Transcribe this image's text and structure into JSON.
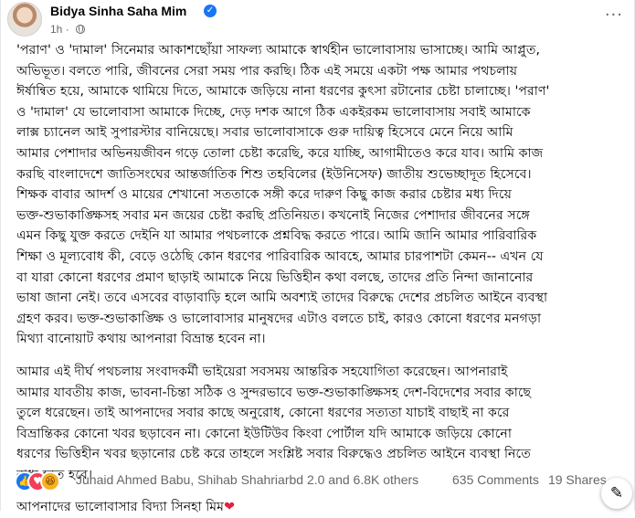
{
  "post": {
    "author": "Bidya Sinha Saha Mim",
    "time": "1h",
    "meta_separator": "·",
    "more_label": "···",
    "verified_mark": "✓",
    "paragraphs": [
      [
        "'পরাণ' ও 'দামাল' সিনেমার আকাশছোঁয়া সাফল্য আমাকে স্বার্থহীন ভালোবাসায় ভাসাচ্ছে। আমি আপ্লুত,",
        "অভিভূত। বলতে পারি, জীবনের সেরা সময় পার করছি। ঠিক এই সময়ে একটা পক্ষ আমার পথচলায়",
        "ঈর্ষান্বিত হয়ে, আমাকে থামিয়ে দিতে, আমাকে জড়িয়ে নানা ধরণের কুৎসা রটানোর চেষ্টা চালাচ্ছে। 'পরাণ'",
        "ও 'দামাল' যে ভালোবাসা আমাকে দিচ্ছে, দেড় দশক আগে ঠিক একইরকম ভালোবাসায় সবাই আমাকে",
        "লাক্স চ্যানেল আই সুপারস্টার বানিয়েছে। সবার ভালোবাসাকে গুরু দায়িত্ব হিসেবে মেনে নিয়ে আমি",
        "আমার পেশাদার অভিনয়জীবন গড়ে তোলা চেষ্টা করেছি, করে যাচ্ছি, আগামীতেও করে যাব। আমি কাজ",
        "করছি বাংলাদেশে জাতিসংঘের আন্তর্জাতিক শিশু তহবিলের (ইউনিসেফ) জাতীয় শুভেচ্ছাদূত হিসেবে।",
        "শিক্ষক বাবার আদর্শ ও মায়ের শেখানো সততাকে সঙ্গী করে দারুণ কিছু কাজ করার চেষ্টার মধ্য দিয়ে",
        "ভক্ত-শুভাকাঙ্ক্ষিসহ সবার মন জয়ের চেষ্টা করছি প্রতিনিয়ত। কখনোই নিজের পেশাদার জীবনের সঙ্গে",
        "এমন কিছু যুক্ত করতে দেইনি যা আমার পথচলাকে প্রশ্নবিদ্ধ করতে পারে। আমি জানি আমার পারিবারিক",
        "শিক্ষা ও মূল্যবোধ কী, বেড়ে ওঠেছি কোন ধরণের পারিবারিক আবহে, আমার চারপাশটা কেমন-- এখন যে",
        "বা যারা কোনো ধরণের প্রমাণ ছাড়াই আমাকে নিয়ে ভিত্তিহীন কথা বলছে, তাদের প্রতি নিন্দা জানানোর",
        "ভাষা জানা নেই। তবে এসবের বাড়াবাড়ি হলে আমি অবশ্যই তাদের বিরুদ্ধে দেশের প্রচলিত আইনে ব্যবস্থা",
        "গ্রহণ করব। ভক্ত-শুভাকাঙ্ক্ষি ও ভালোবাসার মানুষদের এটাও বলতে চাই, কারও কোনো ধরণের মনগড়া",
        "মিথ্যা বানোয়াট কথায় আপনারা বিভ্রান্ত হবেন না।"
      ],
      [
        "আমার এই দীর্ঘ পথচলায় সংবাদকর্মী ভাইয়েরা সবসময় আন্তরিক সহযোগিতা করেছেন। আপনারাই",
        "আমার যাবতীয় কাজ, ভাবনা-চিন্তা সঠিক ও সুন্দরভাবে ভক্ত-শুভাকাঙ্ক্ষিসহ দেশ-বিদেশের সবার কাছে",
        "তুলে ধরেছেন। তাই আপনাদের সবার কাছে অনুরোধ, কোনো ধরণের সত্যতা যাচাই বাছাই না করে",
        "বিভ্রান্তিকর কোনো খবর ছড়াবেন না। কোনো ইউটিউব কিংবা পোর্টাল যদি আমাকে জড়িয়ে কোনো",
        "ধরণের ভিত্তিহীন খবর ছড়ানোর চেষ্ট করে তাহলে সংশ্লিষ্ট সবার বিরুদ্ধেও প্রচলিত আইনে ব্যবস্থা নিতে",
        "বাধ্য হতে হবে।"
      ]
    ],
    "signature": "আপনাদের ভালোবাসার বিদ্যা সিনহা মিম",
    "signature_heart": "❤"
  },
  "footer": {
    "reaction_icons": [
      "like-icon",
      "love-icon",
      "haha-icon"
    ],
    "reaction_glyphs": {
      "like": "👍",
      "love": "♥",
      "haha": "😆"
    },
    "reactions_text": "Junaid Ahmed Babu, Shihab Shahriarbd 2.0 and 6.8K others",
    "comments": "635 Comments",
    "shares": "19 Shares",
    "edit_glyph": "✎"
  },
  "colors": {
    "accent": "#1877f2",
    "love": "#f33e58",
    "haha": "#f7b125",
    "heart": "#e41e3f",
    "muted": "#65676b"
  }
}
